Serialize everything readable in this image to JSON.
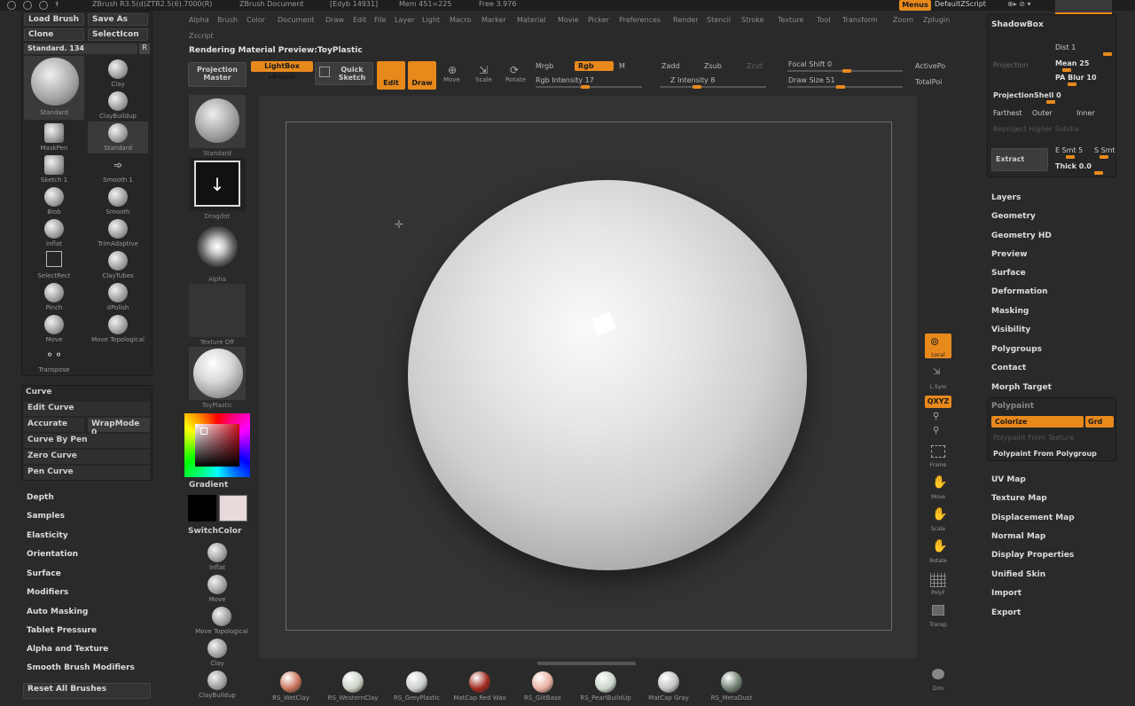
{
  "titlebar": {
    "items": [
      "ZBrush R3.5(d)ZTR2.5(6).7000(R)",
      "ZBrush Document",
      "[Edyb 14931]",
      "Mem 451=225",
      "Free 3.976"
    ],
    "right": [
      "Menus",
      "DefaultZScript"
    ]
  },
  "menu": [
    "Alpha",
    "Brush",
    "Color",
    "Document",
    "Draw",
    "Edit",
    "File",
    "Layer",
    "Light",
    "Macro",
    "Marker",
    "Material",
    "Movie",
    "Picker",
    "Preferences",
    "Render",
    "Stencil",
    "Stroke",
    "Texture",
    "Tool",
    "Transform",
    "Zoom",
    "Zplugin"
  ],
  "quick_label": "Zscript",
  "brush_panel": {
    "load_brush": "Load Brush",
    "save_as": "Save As",
    "clone": "Clone",
    "select_icon": "SelectIcon",
    "current": "Standard. 134",
    "r_label": "R",
    "brushes": [
      {
        "label": "Standard"
      },
      {
        "label": "Clay"
      },
      {
        "label": "ClayBuildup"
      },
      {
        "label": "MaskPen"
      },
      {
        "label": "Standard"
      },
      {
        "label": "Sketch 1"
      },
      {
        "label": "Smooth 1"
      },
      {
        "label": "Blob"
      },
      {
        "label": "Smooth"
      },
      {
        "label": "Inflat"
      },
      {
        "label": "TrimAdaptive"
      },
      {
        "label": "SelectRect"
      },
      {
        "label": "ClayTubes"
      },
      {
        "label": "Pinch"
      },
      {
        "label": "dPolish"
      },
      {
        "label": "Move"
      },
      {
        "label": "Move Topological"
      },
      {
        "label": "Transpose"
      }
    ]
  },
  "curve_panel": {
    "title": "Curve",
    "edit_curve": "Edit Curve",
    "accurate": "Accurate",
    "wrap_mode": "WrapMode 0",
    "curve_by_pen": "Curve By Pen",
    "zero_curve": "Zero Curve",
    "pen_curve": "Pen Curve"
  },
  "left_list": [
    "Depth",
    "Samples",
    "Elasticity",
    "Orientation",
    "Surface",
    "Modifiers",
    "Auto Masking",
    "Tablet Pressure",
    "Alpha and Texture",
    "Smooth Brush Modifiers"
  ],
  "reset_brushes": "Reset All Brushes",
  "tool_column": {
    "thumbs": [
      "Standard",
      "Dragdot",
      "Alpha",
      "Texture Off",
      "ToyPlastic"
    ],
    "gradient": "Gradient",
    "switch_color": "SwitchColor",
    "mini_brushes": [
      "Inflat",
      "Move",
      "Move Topological",
      "Clay",
      "ClayBuildup"
    ],
    "primary_color": "#000000",
    "secondary_color": "#e8dada"
  },
  "shelf": {
    "status": "Rendering Material Preview:ToyPlastic",
    "projection_master": "Projection Master",
    "lightbox": "LightBox ▸Brush",
    "quick_sketch": "Quick Sketch",
    "edit": "Edit",
    "draw": "Draw",
    "move": "Move",
    "scale": "Scale",
    "rotate": "Rotate",
    "mrgb": "Mrgb",
    "rgb": "Rgb",
    "m": "M",
    "rgb_intensity": "Rgb Intensity 17",
    "zadd": "Zadd",
    "zsub": "Zsub",
    "zcut": "Zcut",
    "z_intensity": "Z Intensity 8",
    "focal_shift": "Focal Shift 0",
    "draw_size": "Draw Size 51",
    "active_points": "ActivePo",
    "total_points": "TotalPoi"
  },
  "right_toolbar": [
    "Local",
    "L.Sym",
    "QXYZ",
    "Frame",
    "Move",
    "Scale",
    "Rotate",
    "PolyF",
    "Transp",
    "Dim"
  ],
  "subtool_panel": {
    "shadowbox": "ShadowBox",
    "dist": "Dist 1",
    "mean": "Mean 25",
    "projection": "Projection",
    "pa_blur": "PA Blur 10",
    "projection_shell": "ProjectionShell 0",
    "farthest": "Farthest",
    "outer": "Outer",
    "inner": "Inner",
    "reproject": "Reproject Higher Subdiv",
    "extract": "Extract",
    "e_smt": "E Smt 5",
    "s_smt": "S Smt",
    "thick": "Thick 0.0"
  },
  "right_list_a": [
    "Layers",
    "Geometry",
    "Geometry HD",
    "Preview",
    "Surface",
    "Deformation",
    "Masking",
    "Visibility",
    "Polygroups",
    "Contact",
    "Morph Target"
  ],
  "polypaint": {
    "title": "Polypaint",
    "colorize": "Colorize",
    "grd": "Grd",
    "from_texture": "Polypaint From Texture",
    "from_polygroup": "Polypaint From Polygroup"
  },
  "right_list_b": [
    "UV Map",
    "Texture Map",
    "Displacement Map",
    "Normal Map",
    "Display Properties",
    "Unified Skin",
    "Import",
    "Export"
  ],
  "materials": [
    {
      "label": "RS_WetClay",
      "color": "#c8735a"
    },
    {
      "label": "RS_WesternClay",
      "color": "#c9d0c4"
    },
    {
      "label": "RS_GreyPlastic",
      "color": "#c9cdca"
    },
    {
      "label": "MatCap Red Wax",
      "color": "#a02a1e"
    },
    {
      "label": "RS_GlitBase",
      "color": "#e8b0a0"
    },
    {
      "label": "RS_PearlBuildUp",
      "color": "#c8d4c8"
    },
    {
      "label": "MatCap Gray",
      "color": "#bfc2c0"
    },
    {
      "label": "RS_MetaDust",
      "color": "#6f8070"
    }
  ],
  "accent_color": "#e8891c"
}
